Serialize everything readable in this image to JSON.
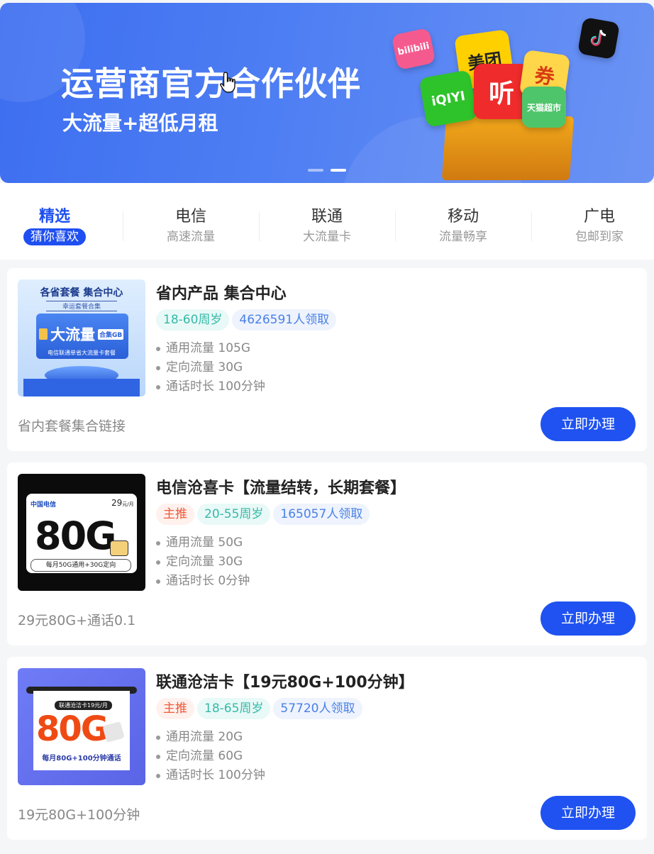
{
  "banner": {
    "title": "运营商官方合作伙伴",
    "subtitle": "大流量+超低月租",
    "apps": [
      "bilibili",
      "美团",
      "iQIYI",
      "听",
      "券",
      "天猫超市",
      "TikTok"
    ]
  },
  "tabs": [
    {
      "label": "精选",
      "sub": "猜你喜欢"
    },
    {
      "label": "电信",
      "sub": "高速流量"
    },
    {
      "label": "联通",
      "sub": "大流量卡"
    },
    {
      "label": "移动",
      "sub": "流量畅享"
    },
    {
      "label": "广电",
      "sub": "包邮到家"
    }
  ],
  "cards": [
    {
      "name": "省内产品 集合中心",
      "tags": {
        "age": "18-60周岁",
        "count": "4626591人领取"
      },
      "features": [
        "通用流量 105G",
        "定向流量 30G",
        "通话时长 100分钟"
      ],
      "desc": "省内套餐集合链接",
      "button": "立即办理",
      "thumb": {
        "line1": "各省套餐  集合中心",
        "line2": "幸运套餐合集",
        "big": "大流量",
        "badge": "合集GB",
        "foot": "电信联通单省大流量卡套餐"
      }
    },
    {
      "name": "电信沧喜卡【流量结转，长期套餐】",
      "tags": {
        "hot": "主推",
        "age": "20-55周岁",
        "count": "165057人领取"
      },
      "features": [
        "通用流量 50G",
        "定向流量 30G",
        "通话时长 0分钟"
      ],
      "desc": "29元80G+通话0.1",
      "button": "立即办理",
      "thumb": {
        "brand": "中国电信",
        "price": "29",
        "unit": "元/月",
        "big": "80G",
        "foot": "每月50G通用+30G定向"
      }
    },
    {
      "name": "联通沧洁卡【19元80G+100分钟】",
      "tags": {
        "hot": "主推",
        "age": "18-65周岁",
        "count": "57720人领取"
      },
      "features": [
        "通用流量 20G",
        "定向流量 60G",
        "通话时长 100分钟"
      ],
      "desc": "19元80G+100分钟",
      "button": "立即办理",
      "thumb": {
        "label": "联通沧洁卡19元/月",
        "big": "80G",
        "foot": "每月80G+100分钟通话"
      }
    }
  ]
}
